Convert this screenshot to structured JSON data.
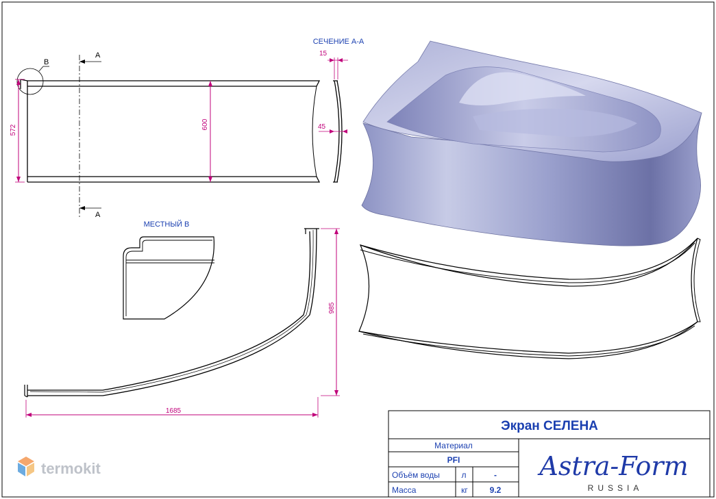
{
  "drawing": {
    "section_title": "СЕЧЕНИЕ А-А",
    "detail_title": "МЕСТНЫЙ В",
    "callout_b": "B",
    "cut_label_top": "A",
    "cut_label_bottom": "A"
  },
  "dimensions": {
    "height_572": "572",
    "height_600": "600",
    "thickness_15": "15",
    "depth_45": "45",
    "height_985": "985",
    "length_1685": "1685"
  },
  "title_block": {
    "title": "Экран СЕЛЕНА",
    "material_label": "Материал",
    "material_value": "PFI",
    "water_label": "Объём воды",
    "water_unit": "л",
    "water_value": "-",
    "mass_label": "Масса",
    "mass_unit": "кг",
    "mass_value": "9.2",
    "brand": "Astra-Form",
    "brand_sub": "RUSSIA"
  },
  "watermark": {
    "text": "termokit",
    "colors": {
      "orange": "#f28a3c",
      "blue": "#3b8fd6",
      "gray": "#a9aeb8"
    }
  },
  "colors": {
    "dimension": "#c0007a",
    "label": "#1a3fb0",
    "line": "#000000"
  }
}
